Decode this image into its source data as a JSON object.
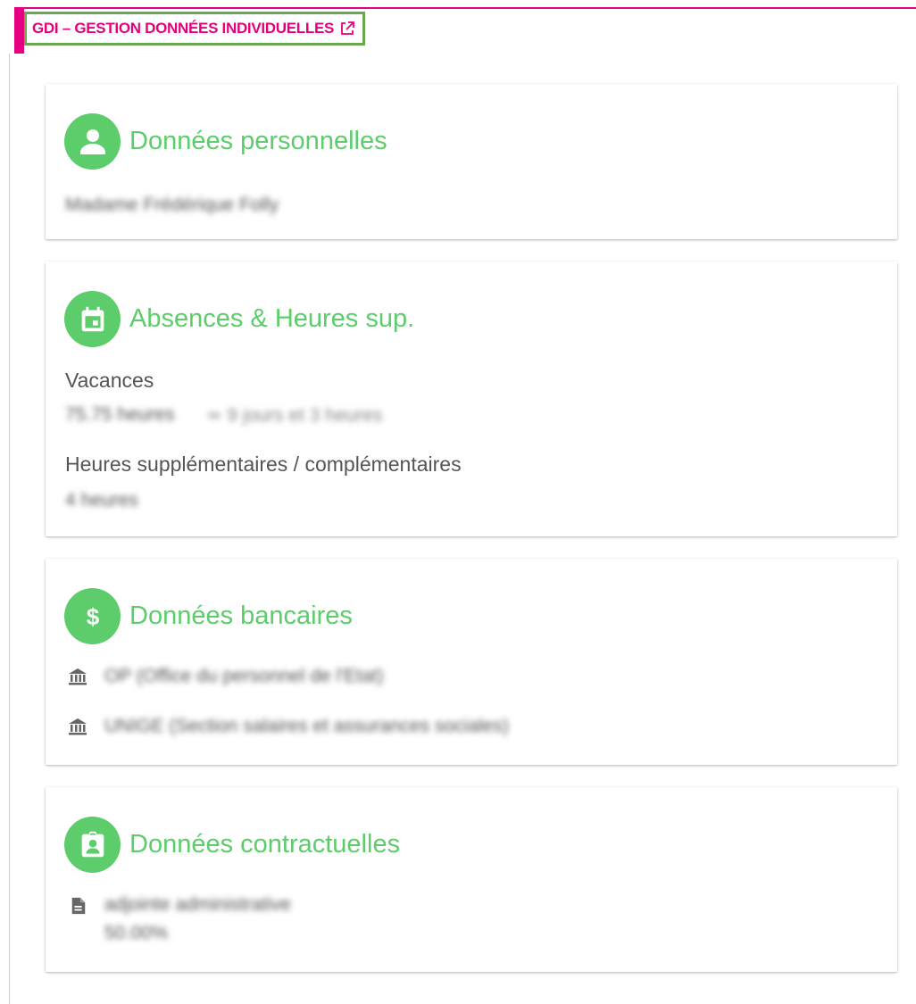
{
  "header": {
    "title": "GDI – GESTION DONNÉES INDIVIDUELLES",
    "link_icon": "external-link-icon"
  },
  "colors": {
    "accent_pink": "#e4007e",
    "accent_green": "#5ccd6a",
    "highlight_border": "#6aa84f"
  },
  "personal": {
    "title": "Données personnelles",
    "icon": "person-icon",
    "name": "Madame Frédérique Folly"
  },
  "absences": {
    "title": "Absences & Heures sup.",
    "icon": "calendar-icon",
    "vacation_label": "Vacances",
    "vacation_hours": "75.75 heures",
    "vacation_days": "≃ 9 jours et 3 heures",
    "overtime_label": "Heures supplémentaires / complémentaires",
    "overtime_value": "4 heures"
  },
  "banking": {
    "title": "Données bancaires",
    "icon": "dollar-icon",
    "items": [
      {
        "icon": "bank-icon",
        "text": "OP (Office du personnel de l'Etat)"
      },
      {
        "icon": "bank-icon",
        "text": "UNIGE (Section salaires et assurances sociales)"
      }
    ]
  },
  "contract": {
    "title": "Données contractuelles",
    "icon": "badge-icon",
    "item_icon": "document-icon",
    "role": "adjointe administrative",
    "rate": "50.00%"
  }
}
